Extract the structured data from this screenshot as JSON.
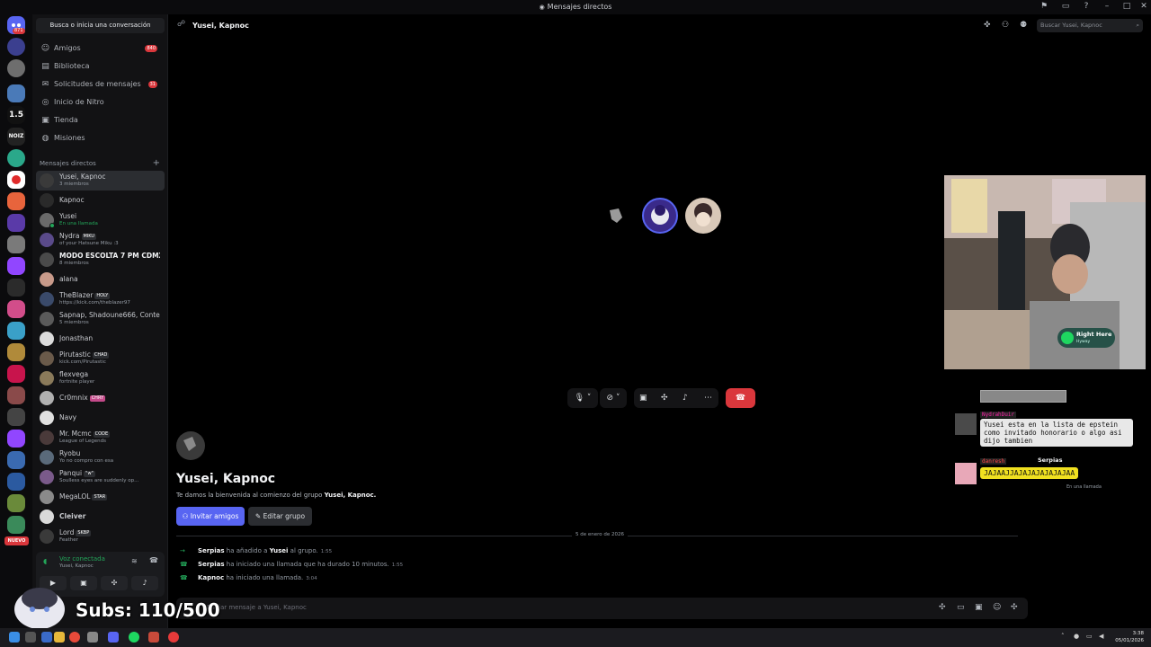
{
  "window": {
    "title": "Mensajes directos"
  },
  "sidebar": {
    "search_label": "Busca o inicia una conversación",
    "nav": [
      {
        "label": "Amigos",
        "badge": "840",
        "icon": "friends-icon"
      },
      {
        "label": "Biblioteca",
        "badge": "",
        "icon": "library-icon"
      },
      {
        "label": "Solicitudes de mensajes",
        "badge": "31",
        "icon": "message-requests-icon"
      },
      {
        "label": "Inicio de Nitro",
        "badge": "",
        "icon": "nitro-icon"
      },
      {
        "label": "Tienda",
        "badge": "",
        "icon": "shop-icon"
      },
      {
        "label": "Misiones",
        "badge": "",
        "icon": "quests-icon"
      }
    ],
    "dm_header": "Mensajes directos",
    "dms": [
      {
        "name": "Yusei, Kapnoc",
        "sub": "3 miembros",
        "tag": "",
        "active": true
      },
      {
        "name": "Kapnoc",
        "sub": "",
        "tag": ""
      },
      {
        "name": "Yusei",
        "sub": "En una llamada",
        "tag": ""
      },
      {
        "name": "Nydra",
        "sub": "of your Hatsune Miku :3",
        "tag": "MIKU"
      },
      {
        "name": "MODO ESCOLTA 7 PM CDMX ...",
        "sub": "8 miembros",
        "tag": ""
      },
      {
        "name": "alana",
        "sub": "",
        "tag": ""
      },
      {
        "name": "TheBlazer",
        "sub": "https://kick.com/theblazer97",
        "tag": "HOLY"
      },
      {
        "name": "Sapnap, Shadoune666, Conte...",
        "sub": "5 miembros",
        "tag": ""
      },
      {
        "name": "Jonasthan",
        "sub": "",
        "tag": ""
      },
      {
        "name": "Pirutastic",
        "sub": "kick.com/Pirutastic",
        "tag": "CHAD"
      },
      {
        "name": "flexvega",
        "sub": "fortnite player",
        "tag": ""
      },
      {
        "name": "Cr0mnix",
        "sub": "",
        "tag": "CHRY"
      },
      {
        "name": "Navy",
        "sub": "",
        "tag": ""
      },
      {
        "name": "Mr. Mcmc",
        "sub": "League of Legends",
        "tag": "CODE"
      },
      {
        "name": "Ryobu",
        "sub": "Yo no compro con esa",
        "tag": ""
      },
      {
        "name": "Panqui",
        "sub": "Soulless eyes are suddenly op...",
        "tag": "\"w\""
      },
      {
        "name": "MegaLOL",
        "sub": "",
        "tag": "STAR"
      },
      {
        "name": "Cleiver",
        "sub": "",
        "tag": ""
      },
      {
        "name": "Lord",
        "sub": "Feather",
        "tag": "SKBP"
      }
    ],
    "voice": {
      "status": "Voz conectada",
      "channel": "Yusei, Kapnoc"
    },
    "nuevo": "NUEVO"
  },
  "rail_badges": {
    "top": "871"
  },
  "channel": {
    "title": "Yusei, Kapnoc",
    "search_placeholder": "Buscar Yusei, Kapnoc"
  },
  "stream": {
    "song_title": "Right Here",
    "song_artist": "Hyway"
  },
  "overlay_chat": [
    {
      "user": "NydrahDuir",
      "text": "Yusei esta en la lista de epstein como invitado honorario o algo asi dijo tambien"
    },
    {
      "user": "danresh",
      "text": "JAJAAJJAJAJAJAJAJAJAA"
    },
    {
      "user": "Serpias",
      "text": "En una llamada"
    }
  ],
  "chat": {
    "welcome_title": "Yusei, Kapnoc",
    "welcome_pre": "Te damos la bienvenida al comienzo del grupo ",
    "welcome_group": "Yusei, Kapnoc.",
    "invite_label": "Invitar amigos",
    "edit_label": "Editar grupo",
    "date": "5 de enero de 2026",
    "system": [
      {
        "actor": "Serpias",
        "text": " ha añadido a ",
        "target": "Yusei",
        "tail": " al grupo.",
        "time": "1:55"
      },
      {
        "actor": "Serpias",
        "text": " ha iniciado una llamada que ha durado 10 minutos.",
        "target": "",
        "tail": "",
        "time": "1:55"
      },
      {
        "actor": "Kapnoc",
        "text": " ha iniciado una llamada.",
        "target": "",
        "tail": "",
        "time": "3:04"
      }
    ],
    "composer_placeholder": "Enviar mensaje a Yusei, Kapnoc"
  },
  "subs_overlay": "Subs: 110/500",
  "taskbar": {
    "time": "3:38",
    "date": "05/01/2026"
  },
  "colors": {
    "accent": "#5865f2",
    "danger": "#da373c",
    "online": "#23a559"
  }
}
